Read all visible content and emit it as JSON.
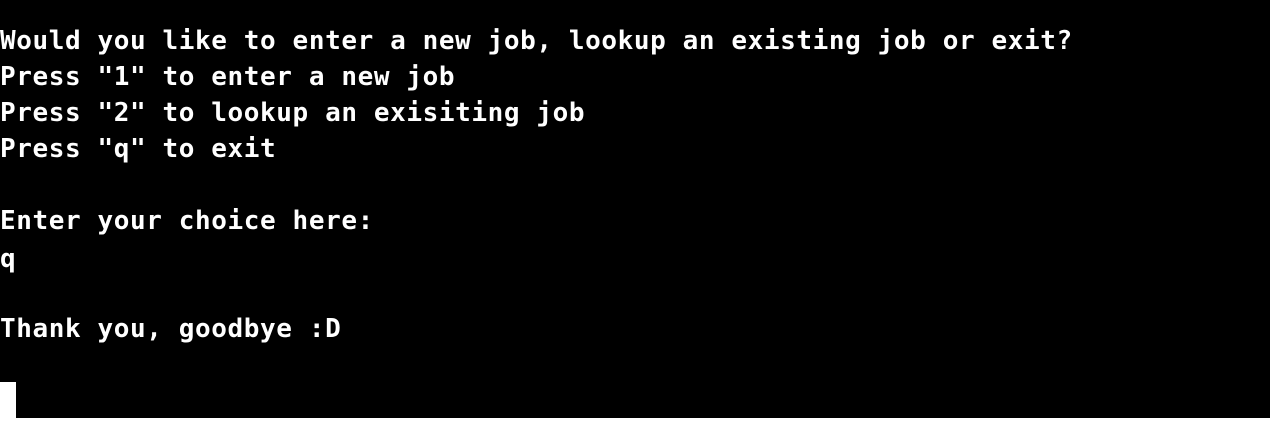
{
  "terminal": {
    "lines": {
      "prompt_question": "Would you like to enter a new job, lookup an existing job or exit?",
      "option_new_job": "Press \"1\" to enter a new job",
      "option_lookup_job": "Press \"2\" to lookup an exisiting job",
      "option_exit": "Press \"q\" to exit",
      "choice_prompt": "Enter your choice here:",
      "user_input": "q",
      "goodbye_message": "Thank you, goodbye :D"
    },
    "colors": {
      "background": "#000000",
      "text": "#ffffff",
      "cursor": "#ffffff"
    }
  }
}
